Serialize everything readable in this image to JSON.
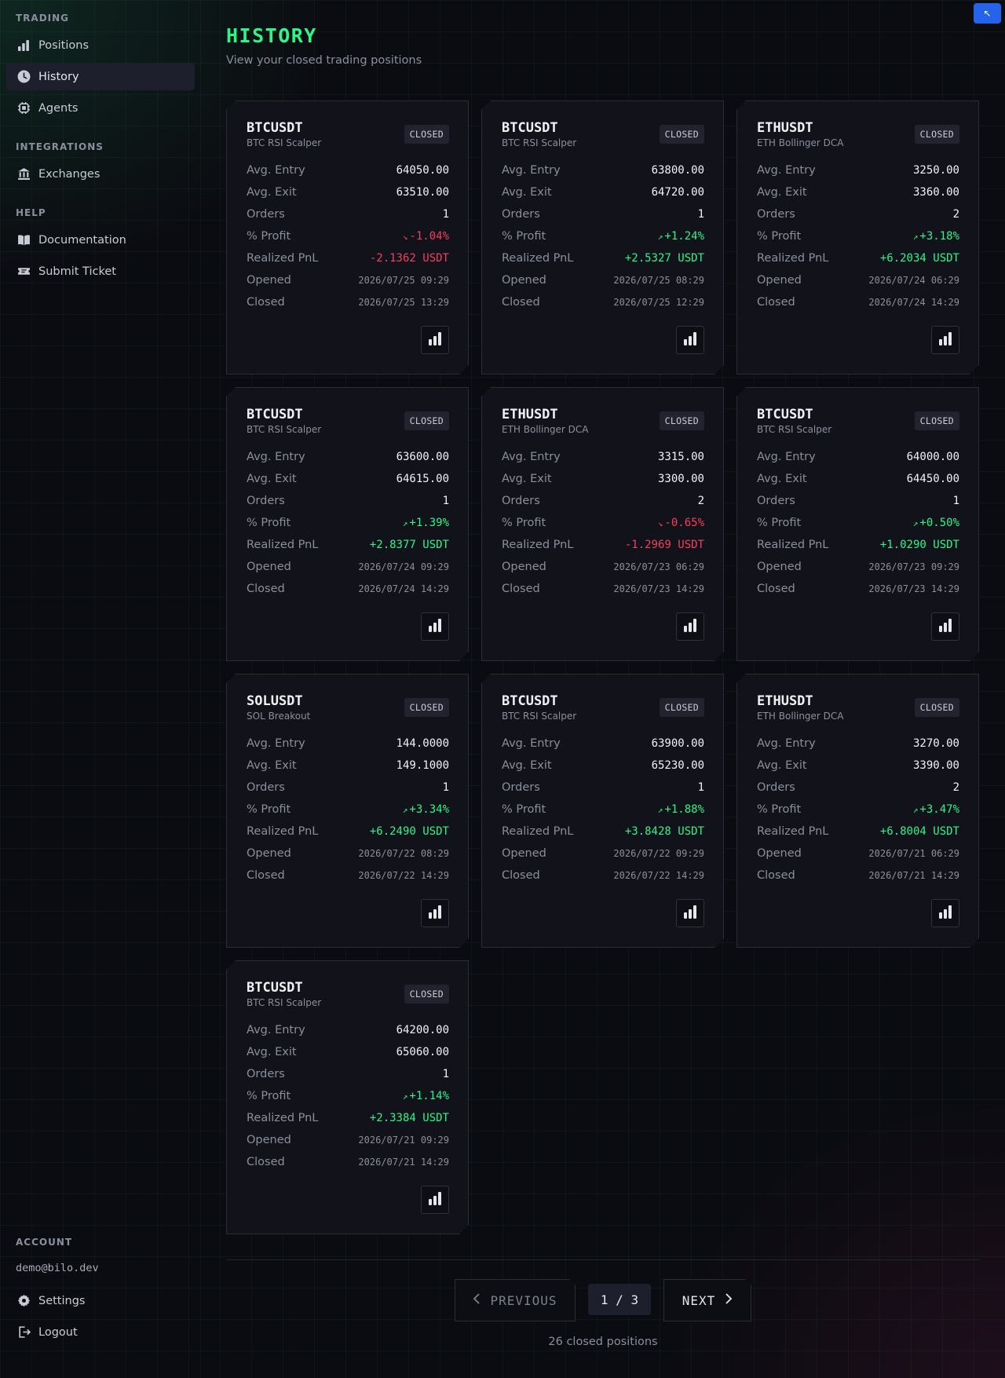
{
  "sidebar": {
    "sections": [
      {
        "title": "TRADING",
        "items": [
          {
            "label": "Positions",
            "icon": "bar-chart-icon"
          },
          {
            "label": "History",
            "icon": "clock-icon",
            "active": true
          },
          {
            "label": "Agents",
            "icon": "chip-icon"
          }
        ]
      },
      {
        "title": "INTEGRATIONS",
        "items": [
          {
            "label": "Exchanges",
            "icon": "bank-icon"
          }
        ]
      },
      {
        "title": "HELP",
        "items": [
          {
            "label": "Documentation",
            "icon": "book-icon"
          },
          {
            "label": "Submit Ticket",
            "icon": "ticket-icon"
          }
        ]
      }
    ],
    "account": {
      "title": "ACCOUNT",
      "email": "demo@bilo.dev",
      "settings": "Settings",
      "logout": "Logout"
    }
  },
  "header": {
    "title": "HISTORY",
    "subtitle": "View your closed trading positions"
  },
  "colors": {
    "accent": "#2df58a",
    "negative": "#f43f5e",
    "corner_button": "#2563eb"
  },
  "labels": {
    "avg_entry": "Avg. Entry",
    "avg_exit": "Avg. Exit",
    "orders": "Orders",
    "profit": "% Profit",
    "pnl": "Realized PnL",
    "opened": "Opened",
    "closed": "Closed"
  },
  "positions": [
    {
      "symbol": "BTCUSDT",
      "agent": "BTC RSI Scalper",
      "status": "CLOSED",
      "entry": "64050.00",
      "exit": "63510.00",
      "orders": "1",
      "profit": "-1.04%",
      "profit_dir": "down",
      "pnl": "-2.1362 USDT",
      "opened": "2026/07/25 09:29",
      "closed": "2026/07/25 13:29"
    },
    {
      "symbol": "BTCUSDT",
      "agent": "BTC RSI Scalper",
      "status": "CLOSED",
      "entry": "63800.00",
      "exit": "64720.00",
      "orders": "1",
      "profit": "+1.24%",
      "profit_dir": "up",
      "pnl": "+2.5327 USDT",
      "opened": "2026/07/25 08:29",
      "closed": "2026/07/25 12:29"
    },
    {
      "symbol": "ETHUSDT",
      "agent": "ETH Bollinger DCA",
      "status": "CLOSED",
      "entry": "3250.00",
      "exit": "3360.00",
      "orders": "2",
      "profit": "+3.18%",
      "profit_dir": "up",
      "pnl": "+6.2034 USDT",
      "opened": "2026/07/24 06:29",
      "closed": "2026/07/24 14:29"
    },
    {
      "symbol": "BTCUSDT",
      "agent": "BTC RSI Scalper",
      "status": "CLOSED",
      "entry": "63600.00",
      "exit": "64615.00",
      "orders": "1",
      "profit": "+1.39%",
      "profit_dir": "up",
      "pnl": "+2.8377 USDT",
      "opened": "2026/07/24 09:29",
      "closed": "2026/07/24 14:29"
    },
    {
      "symbol": "ETHUSDT",
      "agent": "ETH Bollinger DCA",
      "status": "CLOSED",
      "entry": "3315.00",
      "exit": "3300.00",
      "orders": "2",
      "profit": "-0.65%",
      "profit_dir": "down",
      "pnl": "-1.2969 USDT",
      "opened": "2026/07/23 06:29",
      "closed": "2026/07/23 14:29"
    },
    {
      "symbol": "BTCUSDT",
      "agent": "BTC RSI Scalper",
      "status": "CLOSED",
      "entry": "64000.00",
      "exit": "64450.00",
      "orders": "1",
      "profit": "+0.50%",
      "profit_dir": "up",
      "pnl": "+1.0290 USDT",
      "opened": "2026/07/23 09:29",
      "closed": "2026/07/23 14:29"
    },
    {
      "symbol": "SOLUSDT",
      "agent": "SOL Breakout",
      "status": "CLOSED",
      "entry": "144.0000",
      "exit": "149.1000",
      "orders": "1",
      "profit": "+3.34%",
      "profit_dir": "up",
      "pnl": "+6.2490 USDT",
      "opened": "2026/07/22 08:29",
      "closed": "2026/07/22 14:29"
    },
    {
      "symbol": "BTCUSDT",
      "agent": "BTC RSI Scalper",
      "status": "CLOSED",
      "entry": "63900.00",
      "exit": "65230.00",
      "orders": "1",
      "profit": "+1.88%",
      "profit_dir": "up",
      "pnl": "+3.8428 USDT",
      "opened": "2026/07/22 09:29",
      "closed": "2026/07/22 14:29"
    },
    {
      "symbol": "ETHUSDT",
      "agent": "ETH Bollinger DCA",
      "status": "CLOSED",
      "entry": "3270.00",
      "exit": "3390.00",
      "orders": "2",
      "profit": "+3.47%",
      "profit_dir": "up",
      "pnl": "+6.8004 USDT",
      "opened": "2026/07/21 06:29",
      "closed": "2026/07/21 14:29"
    },
    {
      "symbol": "BTCUSDT",
      "agent": "BTC RSI Scalper",
      "status": "CLOSED",
      "entry": "64200.00",
      "exit": "65060.00",
      "orders": "1",
      "profit": "+1.14%",
      "profit_dir": "up",
      "pnl": "+2.3384 USDT",
      "opened": "2026/07/21 09:29",
      "closed": "2026/07/21 14:29"
    }
  ],
  "pagination": {
    "previous": "PREVIOUS",
    "next": "NEXT",
    "indicator": "1 / 3",
    "total": "26 closed positions"
  }
}
